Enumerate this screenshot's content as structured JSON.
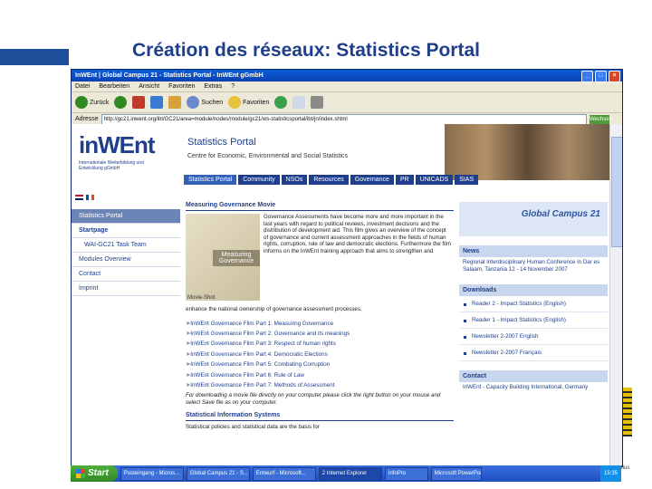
{
  "slide": {
    "title": "Création des réseaux: Statistics Portal"
  },
  "browser": {
    "window_title": "InWEnt | Global Campus 21 - Statistics Portal - InWEnt gGmbH",
    "menu": [
      "Datei",
      "Bearbeiten",
      "Ansicht",
      "Favoriten",
      "Extras",
      "?"
    ],
    "toolbar": {
      "back": "Zurück",
      "search": "Suchen",
      "favorites": "Favoriten"
    },
    "address_label": "Adresse",
    "address_value": "http://gc21.inwent.org/ibt/GC21/area=module/nodes/module/gc21/ws-statisticsportal/ibt/jn/index.shtml",
    "go_label": "Wechseln zu"
  },
  "site": {
    "logo": "inWEnt",
    "logo_sub": "Internationale Weiterbildung und Entwicklung gGmbH",
    "portal_title": "Statistics Portal",
    "portal_sub": "Centre for Economic, Environmental and Social Statistics",
    "nav": [
      "Statistics Portal",
      "Community",
      "NSOs",
      "Resources",
      "Governance",
      "PR",
      "UNICADS",
      "SIAS"
    ],
    "sidebar": {
      "header": "Statistics Portal",
      "items": [
        "Startpage",
        "WAI-GC21 Task Team",
        "Modules Overview",
        "Contact",
        "Imprint"
      ]
    },
    "movie": {
      "title": "Measuring Governance Movie",
      "caption": "Measuring Governance",
      "tag": "Movie-Shot",
      "text": "Governance Assessments have become more and more important in the last years with regard to political reviews, investment decisions and the distribution of development aid. This film gives an overview of the concept of governance and current assessment approaches in the fields of human rights, corruption, rule of law and democratic elections. Furthermore the film informs on the InWEnt training approach that aims to strengthen and",
      "text2": "enhance the national ownership of governance assessment processes."
    },
    "films": [
      "InWEnt Governance Film Part 1: Measuring Governance",
      "InWEnt Governance Film Part 2: Governance and its meanings",
      "InWEnt Governance Film Part 3: Respect of human rights",
      "InWEnt Governance Film Part 4: Democratic Elections",
      "InWEnt Governance Film Part 5: Combating Corruption",
      "InWEnt Governance Film Part 6: Rule of Law",
      "InWEnt Governance Film Part 7: Methods of Assessment"
    ],
    "note": "For downloading a movie file directly on your computer please click the right button on your mouse and select Save file as on your computer.",
    "stat_title": "Statistical Information Systems",
    "stat_text": "Statistical policies and statistical data are the basis for",
    "gc_label": "Global Campus 21",
    "news_head": "News",
    "news_text": "Regional Interdisciplinary Human Conference in Dar es Salaam, Tanzania 12 - 14 November 2007",
    "downloads_head": "Downloads",
    "downloads": [
      "Reader 2 - Impact Statistics (English)",
      "Reader 1 - Impact Statistics (English)",
      "Newsletter 2-2007 English",
      "Newsletter 2-2007 Français"
    ],
    "contact_head": "Contact",
    "contact_text": "InWEnt - Capacity Building International, Germany"
  },
  "taskbar": {
    "start": "Start",
    "tasks": [
      "Posteingang - Micros...",
      "Global Campus 21 - S...",
      "Entwurf - Microsoft...",
      "2 Internet Explorer",
      "InfoPro",
      "Microsoft PowerPoint"
    ],
    "tray_time": "15:35",
    "stub_text": "tius"
  }
}
